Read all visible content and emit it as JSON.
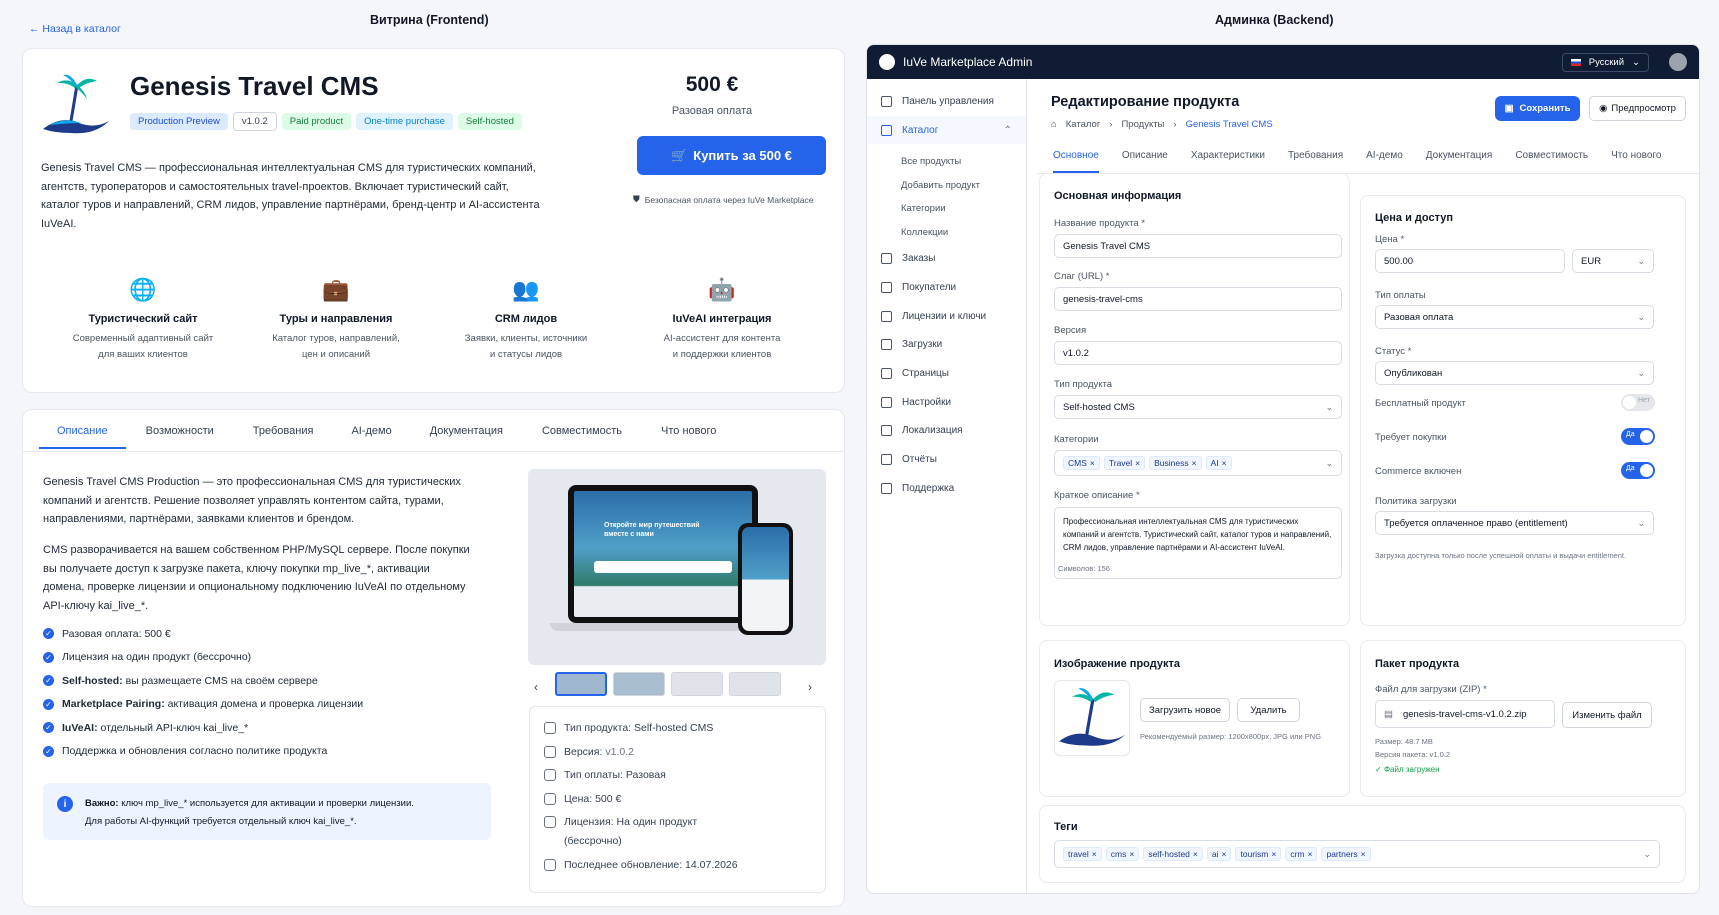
{
  "titles": {
    "frontend": "Витрина (Frontend)",
    "backend": "Админка (Backend)"
  },
  "front": {
    "back_link": "← Назад в каталог",
    "product_title": "Genesis Travel CMS",
    "badges": [
      "Production Preview",
      "v1.0.2",
      "Paid product",
      "One-time purchase",
      "Self-hosted"
    ],
    "description": "Genesis Travel CMS — профессиональная интеллектуальная CMS для туристических компаний, агентств, туроператоров и самостоятельных travel-проектов. Включает туристический сайт, каталог туров и направлений, CRM лидов, управление партнёрами, бренд-центр и AI-ассистента IuVeAI.",
    "price": "500 €",
    "price_note": "Разовая оплата",
    "buy_label": "Купить за 500 €",
    "secure_note": "Безопасная оплата через IuVe Marketplace",
    "features": [
      {
        "icon": "globe-icon",
        "title": "Туристический сайт",
        "desc1": "Современный адаптивный сайт",
        "desc2": "для ваших клиентов"
      },
      {
        "icon": "briefcase-icon",
        "title": "Туры и направления",
        "desc1": "Каталог туров, направлений,",
        "desc2": "цен и описаний"
      },
      {
        "icon": "users-icon",
        "title": "CRM лидов",
        "desc1": "Заявки, клиенты, источники",
        "desc2": "и статусы лидов"
      },
      {
        "icon": "robot-icon",
        "title": "IuVeAI интеграция",
        "desc1": "AI-ассистент для контента",
        "desc2": "и поддержки клиентов"
      }
    ],
    "tabs": [
      "Описание",
      "Возможности",
      "Требования",
      "AI-демо",
      "Документация",
      "Совместимость",
      "Что нового"
    ],
    "body_p1": "Genesis Travel CMS Production — это профессиональная CMS для туристических компаний и агентств. Решение позволяет управлять контентом сайта, турами, направлениями, партнёрами, заявками клиентов и брендом.",
    "body_p2": "CMS разворачивается на вашем собственном PHP/MySQL сервере. После покупки вы получаете доступ к загрузке пакета, ключу покупки mp_live_*, активации домена, проверке лицензии и опциональному подключению IuVeAI по отдельному API-ключу kai_live_*.",
    "checks": [
      {
        "b": "",
        "t": "Разовая оплата: 500 €"
      },
      {
        "b": "",
        "t": "Лицензия на один продукт (бессрочно)"
      },
      {
        "b": "Self-hosted:",
        "t": " вы размещаете CMS на своём сервере"
      },
      {
        "b": "Marketplace Pairing:",
        "t": " активация домена и проверка лицензии"
      },
      {
        "b": "IuVeAI:",
        "t": " отдельный API-ключ kai_live_*"
      },
      {
        "b": "",
        "t": "Поддержка и обновления согласно политике продукта"
      }
    ],
    "notice_bold": "Важно:",
    "notice_l1": " ключ mp_live_* используется для активации и проверки лицензии.",
    "notice_l2": "Для работы AI-функций требуется отдельный ключ kai_live_*.",
    "preview_hero": "Откройте мир путешествий вместе с нами",
    "info": [
      {
        "l": "Тип продукта:",
        "v": " Self-hosted CMS"
      },
      {
        "l": "Версия:",
        "v": " v1.0.2"
      },
      {
        "l": "Тип оплаты:",
        "v": " Разовая"
      },
      {
        "l": "Цена:",
        "v": " 500 €"
      },
      {
        "l": "Лицензия:",
        "v": " На один продукт (бессрочно)"
      },
      {
        "l": "Последнее обновление:",
        "v": " 14.07.2026"
      }
    ]
  },
  "admin": {
    "app_title": "IuVe Marketplace Admin",
    "lang": "Русский",
    "nav": [
      "Панель управления",
      "Каталог",
      "Заказы",
      "Покупатели",
      "Лицензии и ключи",
      "Загрузки",
      "Страницы",
      "Настройки",
      "Локализация",
      "Отчёты",
      "Поддержка"
    ],
    "nav_sub": [
      "Все продукты",
      "Добавить продукт",
      "Категории",
      "Коллекции"
    ],
    "page_title": "Редактирование продукта",
    "crumbs": [
      "Каталог",
      "Продукты",
      "Genesis Travel CMS"
    ],
    "save": "Сохранить",
    "preview": "Предпросмотр",
    "tabs": [
      "Основное",
      "Описание",
      "Характеристики",
      "Требования",
      "AI-демо",
      "Документация",
      "Совместимость",
      "Что нового"
    ],
    "basic": {
      "title": "Основная информация",
      "name_l": "Название продукта *",
      "name_v": "Genesis Travel CMS",
      "slug_l": "Слаг (URL) *",
      "slug_v": "genesis-travel-cms",
      "ver_l": "Версия",
      "ver_v": "v1.0.2",
      "type_l": "Тип продукта",
      "type_v": "Self-hosted CMS",
      "cat_l": "Категории",
      "cats": [
        "CMS",
        "Travel",
        "Business",
        "AI"
      ],
      "short_l": "Краткое описание *",
      "short_v": "Профессиональная интеллектуальная CMS для туристических компаний и агентств. Туристический сайт, каталог туров и направлений, CRM лидов, управление партнёрами и AI-ассистент IuVeAI.",
      "count": "Символов: 156"
    },
    "price": {
      "title": "Цена и доступ",
      "price_l": "Цена *",
      "price_v": "500.00",
      "cur": "EUR",
      "pay_l": "Тип оплаты",
      "pay_v": "Разовая оплата",
      "status_l": "Статус *",
      "status_v": "Опубликован",
      "free_l": "Бесплатный продукт",
      "free_t": "Нет",
      "req_l": "Требует покупки",
      "req_t": "Да",
      "com_l": "Commerce включен",
      "com_t": "Да",
      "dl_l": "Политика загрузки",
      "dl_v": "Требуется оплаченное право (entitlement)",
      "dl_note": "Загрузка доступна только после успешной оплаты и выдачи entitlement."
    },
    "image": {
      "title": "Изображение продукта",
      "upload": "Загрузить новое",
      "delete": "Удалить",
      "rec": "Рекомендуемый размер: 1200x800px, JPG или PNG"
    },
    "package": {
      "title": "Пакет продукта",
      "file_l": "Файл для загрузки (ZIP) *",
      "file_v": "genesis-travel-cms-v1.0.2.zip",
      "change": "Изменить файл",
      "size": "Размер: 48.7 MB",
      "ver": "Версия пакета: v1.0.2",
      "ok": "Файл загружен"
    },
    "tags": {
      "title": "Теги",
      "items": [
        "travel",
        "cms",
        "self-hosted",
        "ai",
        "tourism",
        "crm",
        "partners"
      ]
    }
  },
  "colors": {
    "accent": "#2563eb",
    "navy": "#0f1c33"
  }
}
